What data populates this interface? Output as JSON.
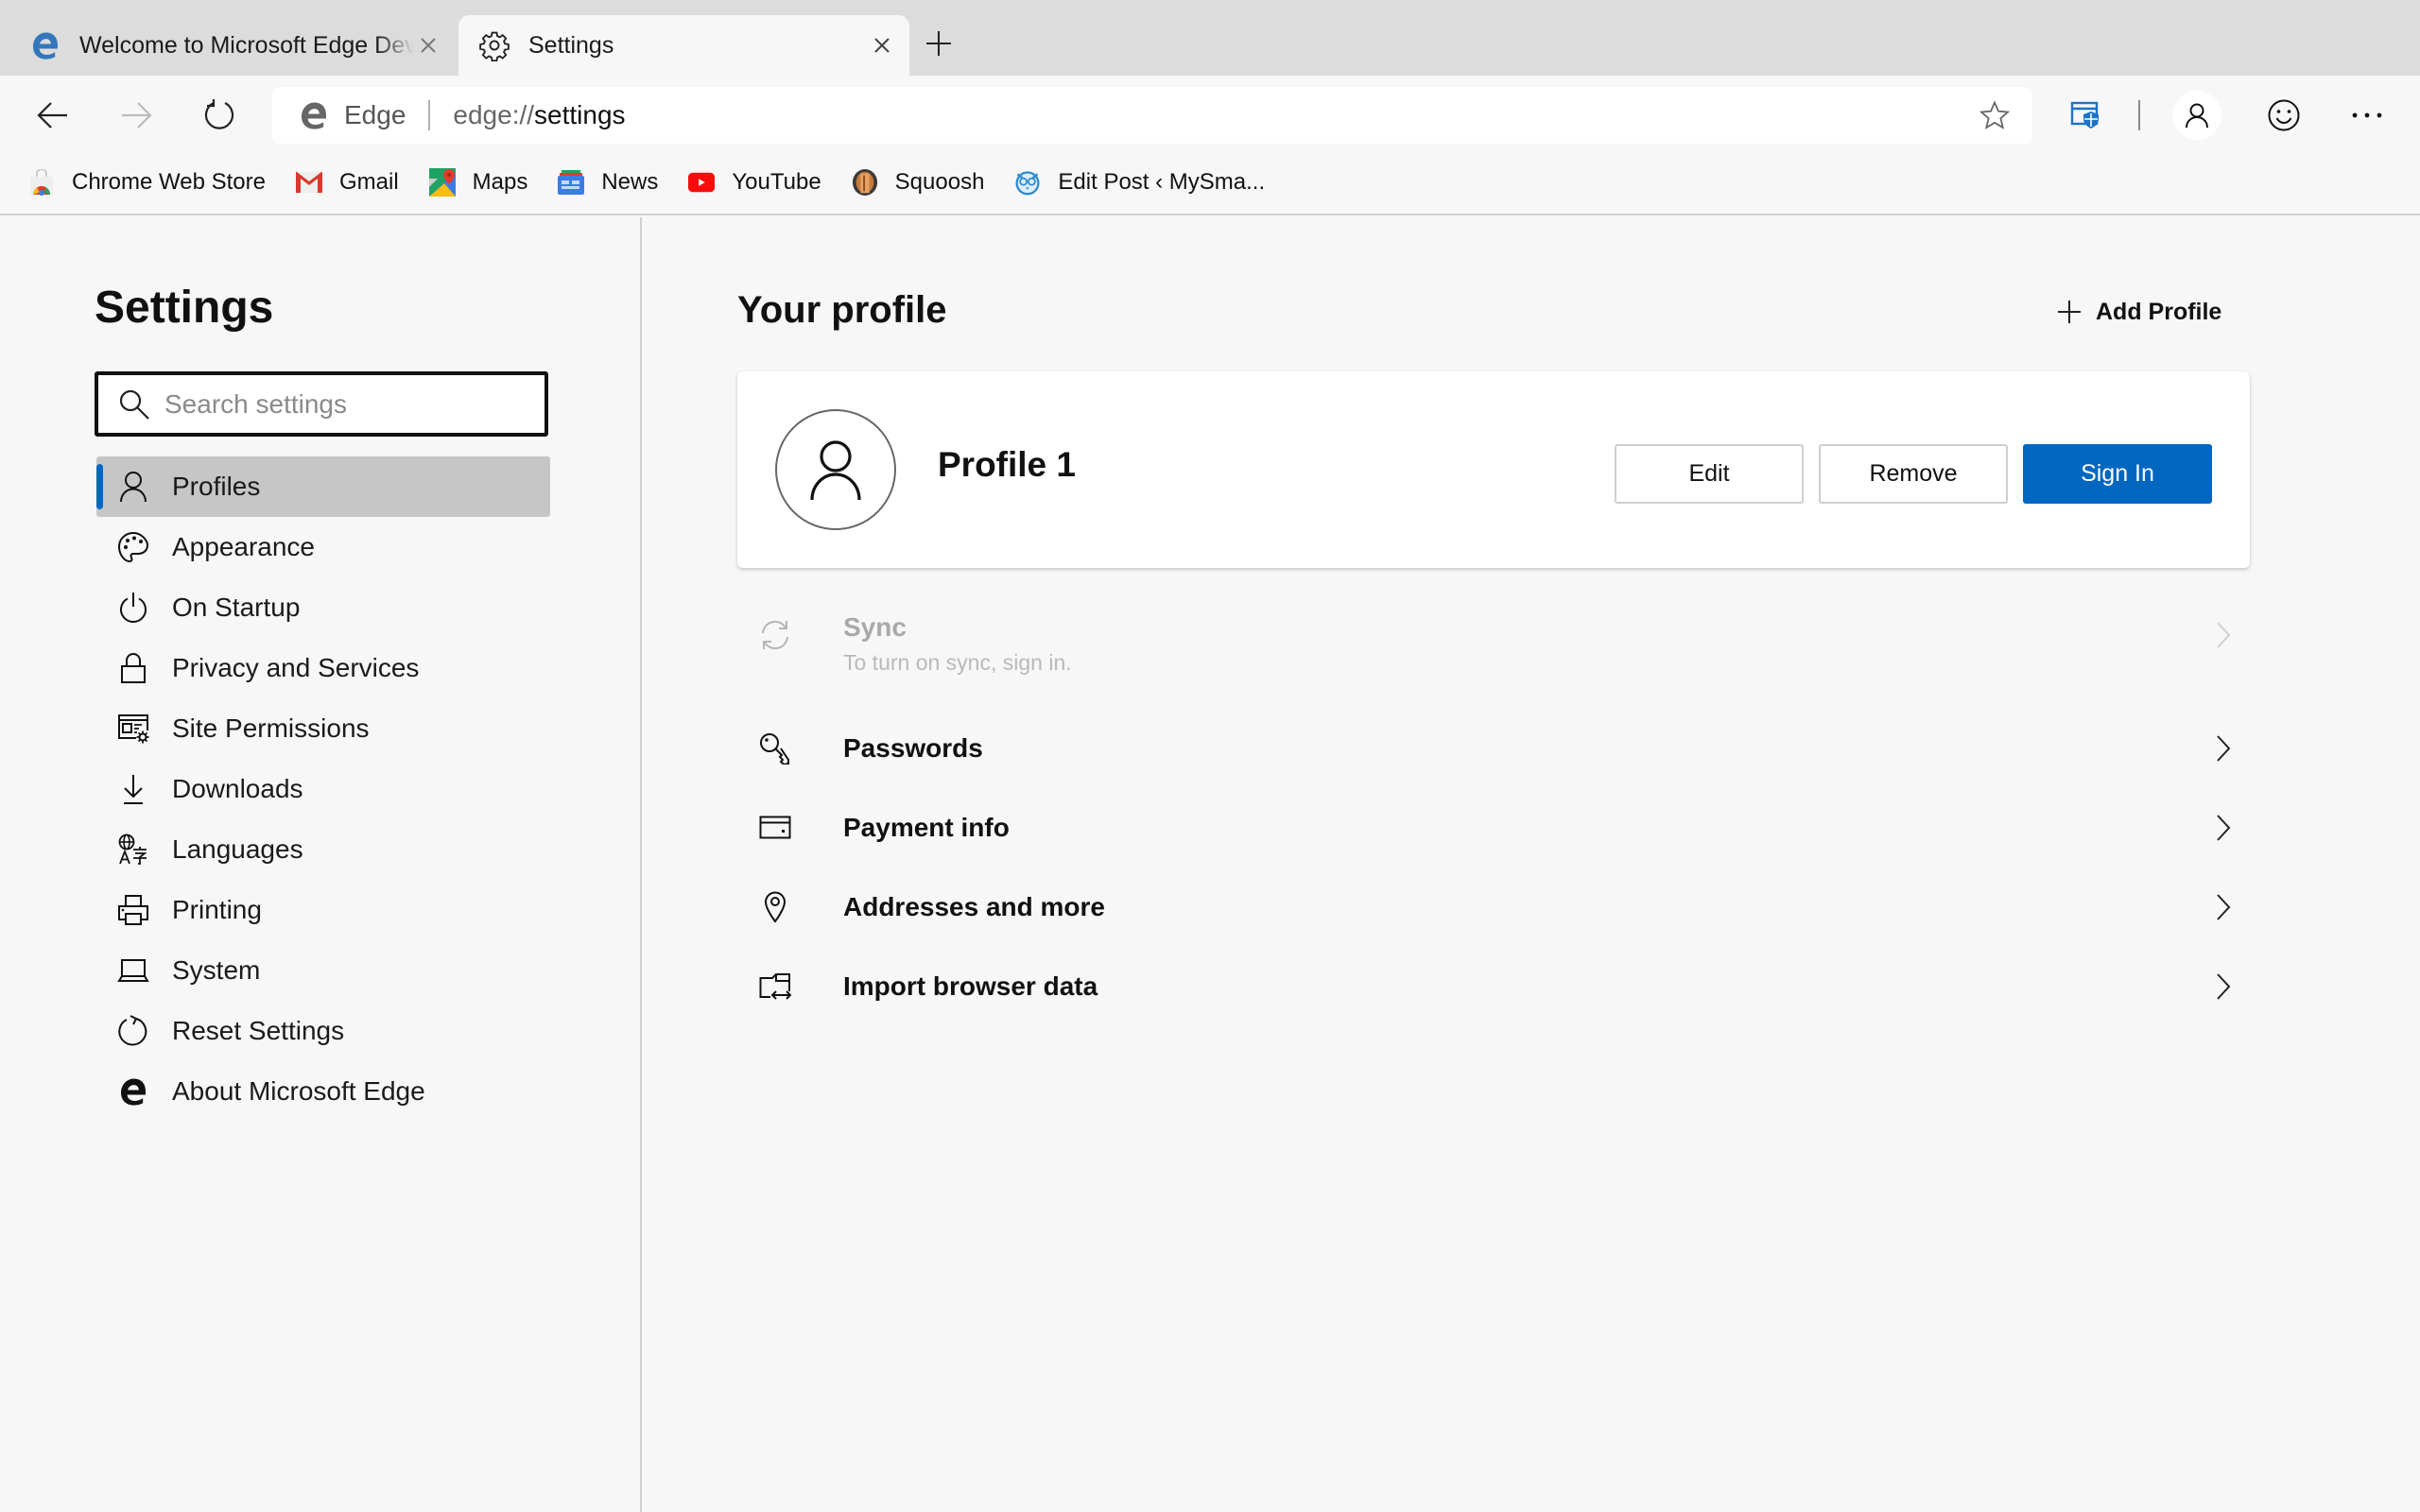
{
  "tabs": [
    {
      "title": "Welcome to Microsoft Edge Dev",
      "icon": "edge-logo-icon",
      "active": false
    },
    {
      "title": "Settings",
      "icon": "gear-icon",
      "active": true
    }
  ],
  "toolbar": {
    "address": {
      "site_name": "Edge",
      "url_scheme": "edge://",
      "url_path": "settings"
    }
  },
  "bookmarks": [
    {
      "label": "Chrome Web Store",
      "icon": "chrome-web-store-icon"
    },
    {
      "label": "Gmail",
      "icon": "gmail-icon"
    },
    {
      "label": "Maps",
      "icon": "maps-icon"
    },
    {
      "label": "News",
      "icon": "news-icon"
    },
    {
      "label": "YouTube",
      "icon": "youtube-icon"
    },
    {
      "label": "Squoosh",
      "icon": "squoosh-icon"
    },
    {
      "label": "Edit Post ‹ MySma...",
      "icon": "owl-icon"
    }
  ],
  "sidebar": {
    "title": "Settings",
    "search_placeholder": "Search settings",
    "search_value": "",
    "items": [
      {
        "label": "Profiles",
        "icon": "person-icon",
        "selected": true
      },
      {
        "label": "Appearance",
        "icon": "palette-icon"
      },
      {
        "label": "On Startup",
        "icon": "power-icon"
      },
      {
        "label": "Privacy and Services",
        "icon": "lock-icon"
      },
      {
        "label": "Site Permissions",
        "icon": "site-permissions-icon"
      },
      {
        "label": "Downloads",
        "icon": "download-icon"
      },
      {
        "label": "Languages",
        "icon": "languages-icon"
      },
      {
        "label": "Printing",
        "icon": "printer-icon"
      },
      {
        "label": "System",
        "icon": "laptop-icon"
      },
      {
        "label": "Reset Settings",
        "icon": "reset-icon"
      },
      {
        "label": "About Microsoft Edge",
        "icon": "edge-logo-icon"
      }
    ]
  },
  "main": {
    "title": "Your profile",
    "add_profile_label": "Add Profile",
    "profile": {
      "name": "Profile 1",
      "edit_label": "Edit",
      "remove_label": "Remove",
      "sign_in_label": "Sign In"
    },
    "rows": [
      {
        "title": "Sync",
        "subtitle": "To turn on sync, sign in.",
        "icon": "sync-icon",
        "disabled": true
      },
      {
        "title": "Passwords",
        "icon": "key-icon"
      },
      {
        "title": "Payment info",
        "icon": "credit-card-icon"
      },
      {
        "title": "Addresses and more",
        "icon": "location-pin-icon"
      },
      {
        "title": "Import browser data",
        "icon": "import-icon"
      }
    ]
  },
  "colors": {
    "accent": "#0067c0",
    "tabstrip_bg": "#dcdcdc",
    "page_bg": "#f7f7f7",
    "selected_nav_bg": "#c6c6c6"
  }
}
